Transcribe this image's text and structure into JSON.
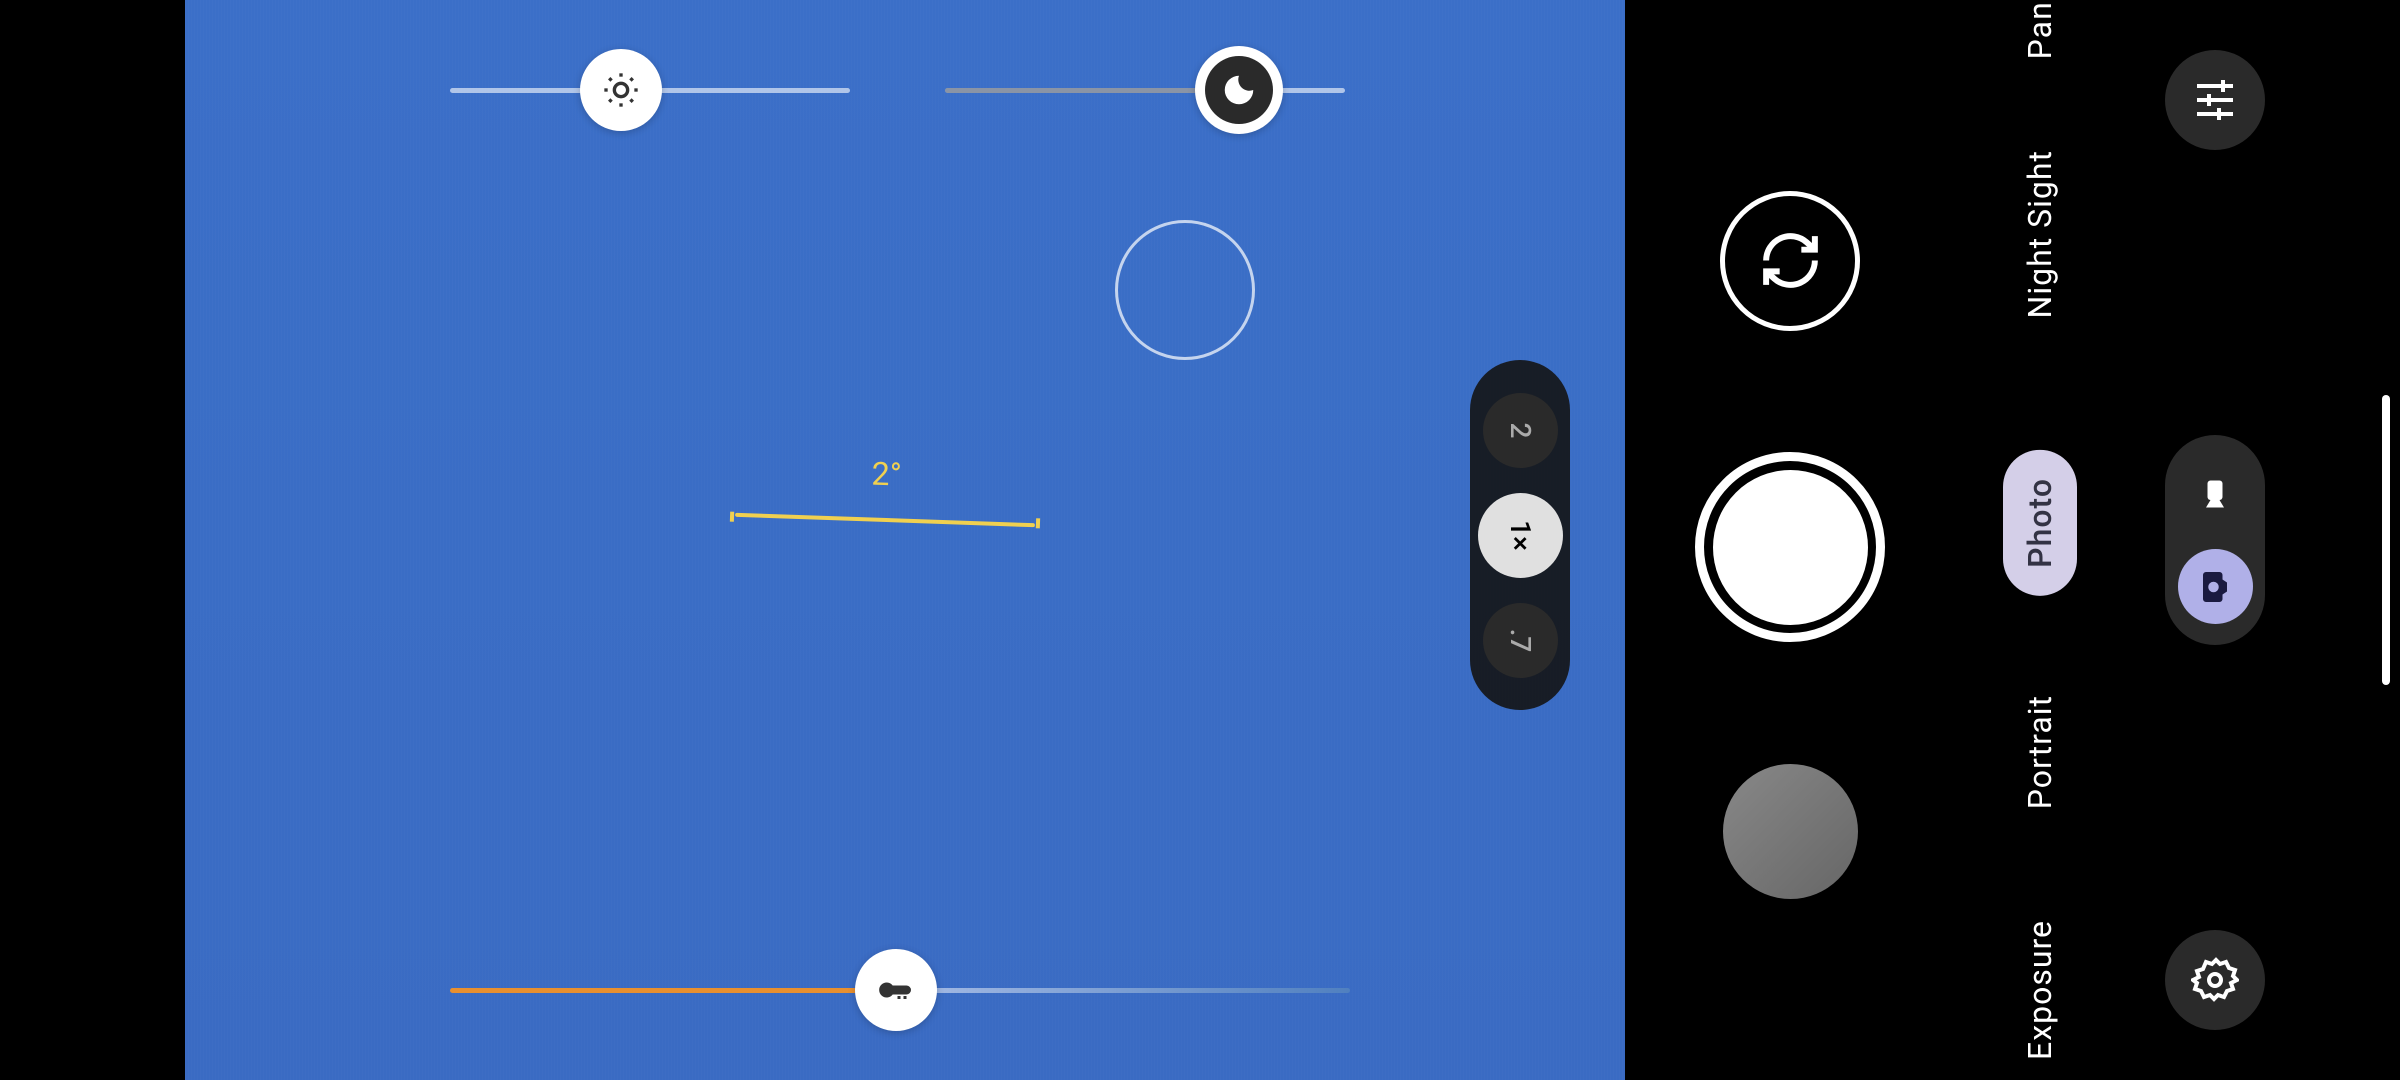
{
  "level": {
    "angle": "2°"
  },
  "sliders": {
    "brightness": {
      "position": 40,
      "icon": "brightness"
    },
    "shadow": {
      "position": 75,
      "icon": "moon"
    },
    "temperature": {
      "position": 49,
      "icon": "thermometer"
    }
  },
  "zoom": {
    "options": [
      {
        "label": "2",
        "active": false
      },
      {
        "label": "1×",
        "active": true
      },
      {
        "label": ".7",
        "active": false
      }
    ]
  },
  "modes": {
    "items": [
      {
        "label": "Pano",
        "active": false
      },
      {
        "label": "Night Sight",
        "active": false
      },
      {
        "label": "Photo",
        "active": true
      },
      {
        "label": "Portrait",
        "active": false
      },
      {
        "label": "Exposure",
        "active": false
      }
    ]
  },
  "edge_buttons": {
    "adjust": "adjustments-icon",
    "settings": "settings-icon"
  },
  "photo_video": {
    "video_active": false,
    "photo_active": true
  }
}
